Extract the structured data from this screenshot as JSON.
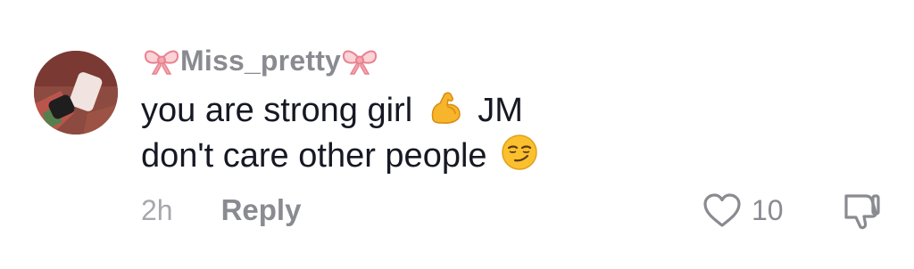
{
  "comment": {
    "username": "Miss_pretty",
    "username_prefix_icon": "ribbon-bow-icon",
    "username_suffix_icon": "ribbon-bow-icon",
    "text_line1_part1": "you are strong girl",
    "text_line1_emoji": "flexed-biceps-emoji",
    "text_line1_part2": "JM",
    "text_line2": "don't care other people",
    "text_line2_emoji": "smirking-face-emoji",
    "time": "2h",
    "reply_label": "Reply",
    "like_count": "10",
    "like_icon": "heart-outline-icon",
    "dislike_icon": "thumbs-down-icon"
  },
  "colors": {
    "username": "#8a8b91",
    "body_text": "#161823",
    "meta_text": "#a7a8ad",
    "bow_pink": "#f4a7b0"
  }
}
